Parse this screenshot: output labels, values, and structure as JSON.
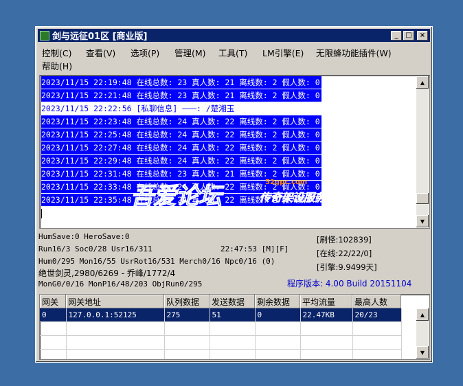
{
  "window": {
    "title": "剑与远征01区 [商业版]",
    "controls": {
      "minimize": "_",
      "maximize": "□",
      "close": "×"
    }
  },
  "menu": [
    "控制(C)",
    "查看(V)",
    "选项(P)",
    "管理(M)",
    "工具(T)",
    "LM引擎(E)",
    "无限蜂功能插件(W)",
    "帮助(H)"
  ],
  "log": [
    "2023/11/15 22:19:48 在线总数: 23 真人数: 21 离线数: 2 假人数: 0",
    "2023/11/15 22:21:48 在线总数: 23 真人数: 21 离线数: 2 假人数: 0",
    "2023/11/15 22:22:56 [私聊信息] ———: /楚湘玉",
    "2023/11/15 22:23:48 在线总数: 24 真人数: 22 离线数: 2 假人数: 0",
    "2023/11/15 22:25:48 在线总数: 24 真人数: 22 离线数: 2 假人数: 0",
    "2023/11/15 22:27:48 在线总数: 24 真人数: 22 离线数: 2 假人数: 0",
    "2023/11/15 22:29:48 在线总数: 24 真人数: 22 离线数: 2 假人数: 0",
    "2023/11/15 22:31:48 在线总数: 23 真人数: 21 离线数: 2 假人数: 0",
    "2023/11/15 22:33:48 在线总数: 24 真人数: 22 离线数: 2 假人数: 0",
    "2023/11/15 22:35:48 在线总数: 24 真人数: 22 离线数: 2 假人数: 0"
  ],
  "status": {
    "line1": "HumSave:0 HeroSave:0",
    "line2": "Run16/3 Soc0/28 Usr16/311",
    "time": "22:47:53 [M][F]",
    "line3": "Hum0/295 Mon16/55 UsrRot16/531 Merch0/16 Npc0/16 (0)",
    "line4": "绝世剑灵,2980/6269 - 乔峰/1772/4",
    "line5": "MonG0/0/16 MonP16/48/203 ObjRun0/295",
    "refresh": "[刷怪:102839]",
    "online": "[在线:22/22/0]",
    "engine": "[引擎:9.9499天]",
    "version": "程序版本: 4.00 Build 20151104"
  },
  "grid": {
    "headers": [
      "网关",
      "网关地址",
      "队列数据",
      "发送数据",
      "剩余数据",
      "平均流量",
      "最高人数"
    ],
    "rows": [
      [
        "0",
        "127.0.0.1:52125",
        "275",
        "51",
        "0",
        "22.47KB",
        "20/23"
      ]
    ]
  },
  "watermark": {
    "big": "吾爱论坛",
    "url": "52gpc.com",
    "small": "传奇架设服务"
  },
  "colors": {
    "desktop": "#3c6ea5",
    "titlebar": "#0a246a",
    "log_highlight": "#0000ff",
    "version_text": "#0000cc"
  }
}
